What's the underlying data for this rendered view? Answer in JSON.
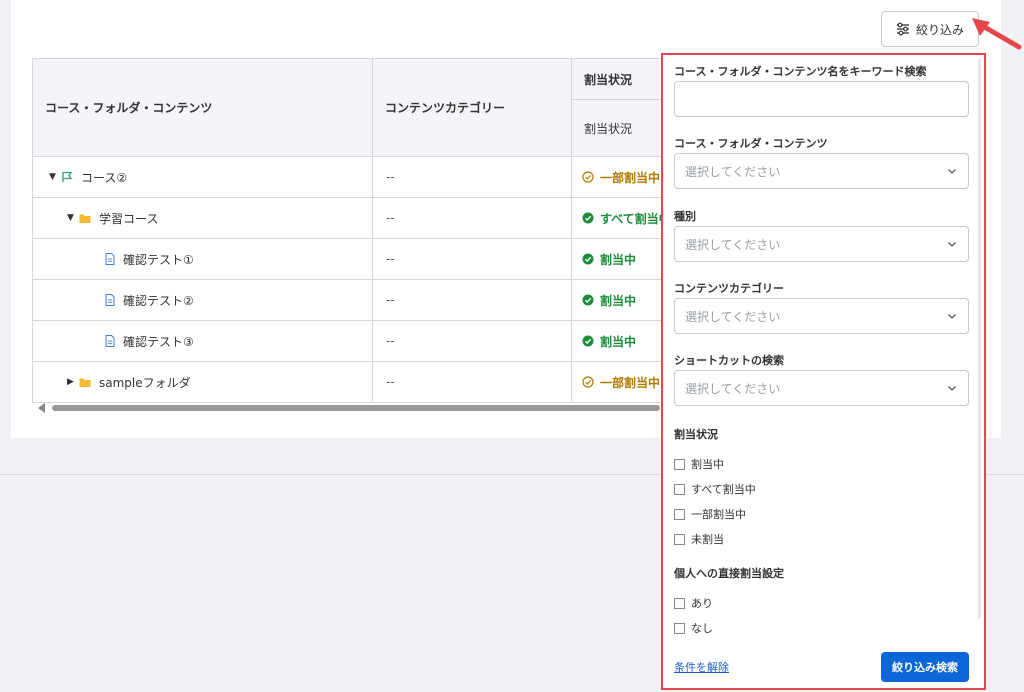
{
  "toolbar": {
    "filter_label": "絞り込み"
  },
  "table": {
    "headers": {
      "name": "コース・フォルダ・コンテンツ",
      "category": "コンテンツカテゴリー",
      "assign_group": "割当状況",
      "assign_sub": "割当状況"
    },
    "rows": [
      {
        "name": "コース②",
        "category": "--",
        "status": "一部割当中"
      },
      {
        "name": "学習コース",
        "category": "--",
        "status": "すべて割当中"
      },
      {
        "name": "確認テスト①",
        "category": "--",
        "status": "割当中"
      },
      {
        "name": "確認テスト②",
        "category": "--",
        "status": "割当中"
      },
      {
        "name": "確認テスト③",
        "category": "--",
        "status": "割当中"
      },
      {
        "name": "sampleフォルダ",
        "category": "--",
        "status": "一部割当中"
      }
    ]
  },
  "filter_panel": {
    "keyword_label": "コース・フォルダ・コンテンツ名をキーワード検索",
    "keyword_value": "",
    "course_label": "コース・フォルダ・コンテンツ",
    "course_placeholder": "選択してください",
    "type_label": "種別",
    "type_placeholder": "選択してください",
    "category_label": "コンテンツカテゴリー",
    "category_placeholder": "選択してください",
    "shortcut_label": "ショートカットの検索",
    "shortcut_placeholder": "選択してください",
    "assign_label": "割当状況",
    "assign_options": [
      "割当中",
      "すべて割当中",
      "一部割当中",
      "未割当"
    ],
    "direct_label": "個人への直接割当設定",
    "direct_options": [
      "あり",
      "なし"
    ],
    "clear_label": "条件を解除",
    "search_label": "絞り込み検索"
  },
  "colors": {
    "accent": "#0b66d8",
    "highlight": "#e6474d",
    "partial": "#b07a00",
    "full": "#1d8c3a"
  }
}
